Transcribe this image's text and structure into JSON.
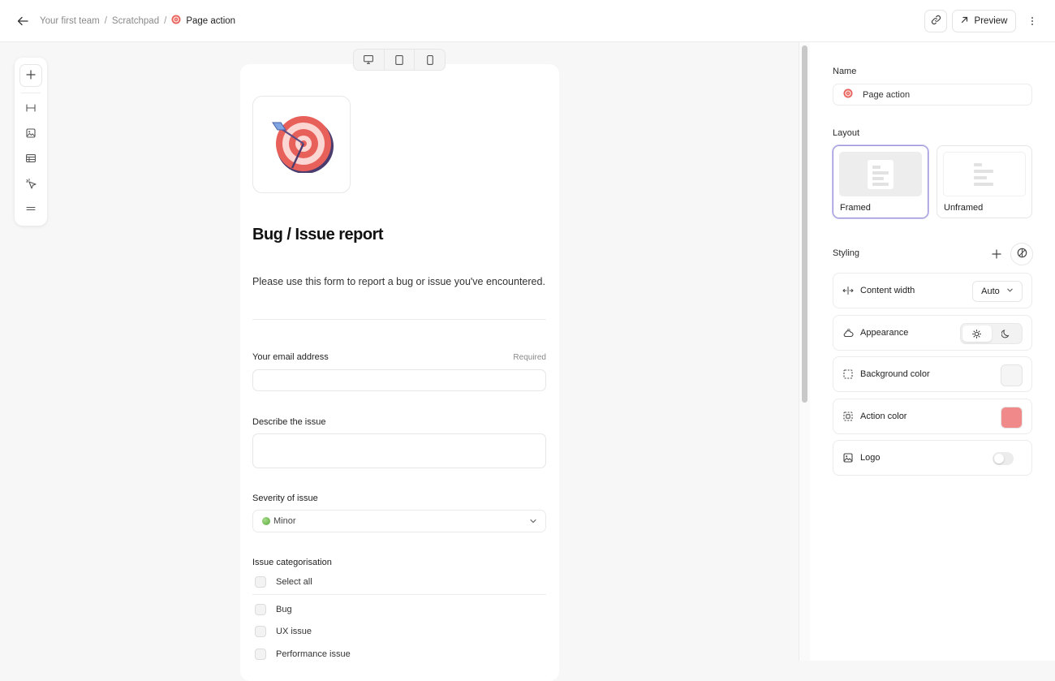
{
  "breadcrumb": {
    "items": [
      "Your first team",
      "Scratchpad"
    ],
    "separator": "/",
    "current": "Page action"
  },
  "toolbar": {
    "preview_label": "Preview"
  },
  "palette": {
    "tools": [
      "add-icon",
      "heading-icon",
      "image-icon",
      "table-icon",
      "cursor-click-icon",
      "divider-icon"
    ]
  },
  "devices": [
    "desktop-icon",
    "tablet-icon",
    "mobile-icon"
  ],
  "form": {
    "title": "Bug / Issue report",
    "description": "Please use this form to report a bug or issue you've encountered.",
    "email_label": "Your email address",
    "required_label": "Required",
    "describe_label": "Describe the issue",
    "severity_label": "Severity of issue",
    "severity_value": "Minor",
    "categorisation_label": "Issue categorisation",
    "select_all_label": "Select all",
    "options": [
      "Bug",
      "UX issue",
      "Performance issue"
    ]
  },
  "panel": {
    "name_label": "Name",
    "name_value": "Page action",
    "layout_label": "Layout",
    "layout_options": [
      "Framed",
      "Unframed"
    ],
    "layout_selected": "Framed",
    "styling_label": "Styling",
    "content_width_label": "Content width",
    "content_width_value": "Auto",
    "appearance_label": "Appearance",
    "appearance_selected": "light",
    "background_color_label": "Background color",
    "background_color": "#f5f5f5",
    "action_color_label": "Action color",
    "action_color": "#f08a8a",
    "logo_label": "Logo",
    "logo_enabled": false
  },
  "colors": {
    "accent_selected_border": "#9c95d8",
    "target_red": "#e8605a"
  }
}
